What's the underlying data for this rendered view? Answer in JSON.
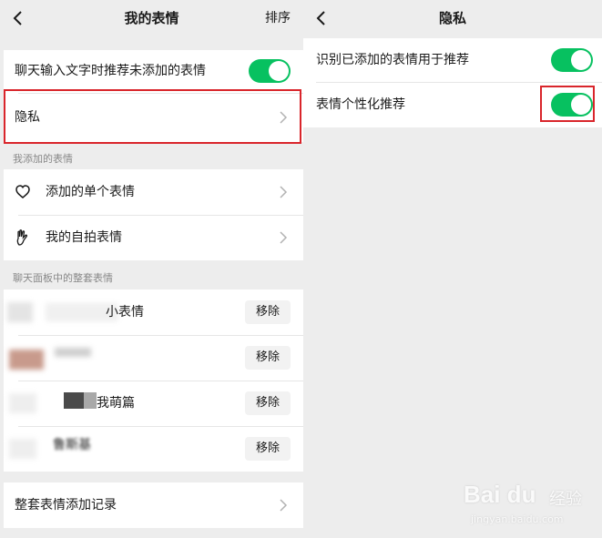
{
  "left": {
    "title": "我的表情",
    "action": "排序",
    "recommend_toggle_label": "聊天输入文字时推荐未添加的表情",
    "privacy_label": "隐私",
    "section_added": "我添加的表情",
    "added_single": "添加的单个表情",
    "my_selfie": "我的自拍表情",
    "section_sets": "聊天面板中的整套表情",
    "sets": [
      {
        "name": "小表情",
        "remove": "移除"
      },
      {
        "name": "",
        "remove": "移除"
      },
      {
        "name": "我萌篇",
        "remove": "移除"
      },
      {
        "name": "鲁斯基",
        "remove": "移除"
      }
    ],
    "history_label": "整套表情添加记录"
  },
  "right": {
    "title": "隐私",
    "identify_label": "识别已添加的表情用于推荐",
    "personalized_label": "表情个性化推荐"
  },
  "toggles": {
    "recommend_on": true,
    "identify_on": true,
    "personalized_on": true
  },
  "colors": {
    "toggle_on": "#07c160",
    "highlight": "#d9252b"
  },
  "watermark": {
    "brand": "Bai du",
    "cn": "经验",
    "url": "jingyan.baidu.com"
  }
}
